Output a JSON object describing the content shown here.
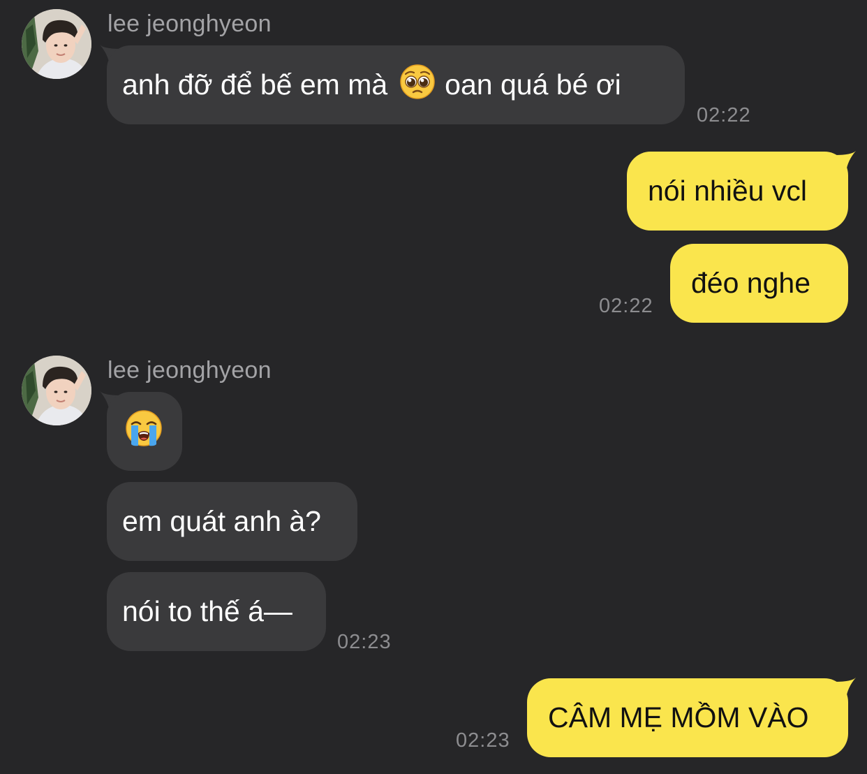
{
  "chat": {
    "groups": [
      {
        "sender": "lee jeonghyeon",
        "messages": [
          {
            "before": "anh đỡ để bế em mà",
            "emoji": "pleading-face",
            "after": "oan quá bé ơi"
          }
        ],
        "time": "02:22"
      },
      {
        "outgoing": [
          {
            "text": "nói nhiều vcl"
          },
          {
            "text": "đéo nghe"
          }
        ],
        "time": "02:22"
      },
      {
        "sender": "lee jeonghyeon",
        "messages": [
          {
            "emoji": "loudly-crying-face"
          },
          {
            "text": "em quát anh à?"
          },
          {
            "text": "nói to thế á—"
          }
        ],
        "time": "02:23"
      },
      {
        "outgoing": [
          {
            "text": "CÂM MẸ MỒM VÀO"
          }
        ],
        "time": "02:23"
      }
    ]
  },
  "colors": {
    "background": "#262628",
    "incoming_bubble": "#3a3a3c",
    "outgoing_bubble": "#fae54d",
    "timestamp": "#8d8d90",
    "sender_name": "#a3a3a6"
  }
}
